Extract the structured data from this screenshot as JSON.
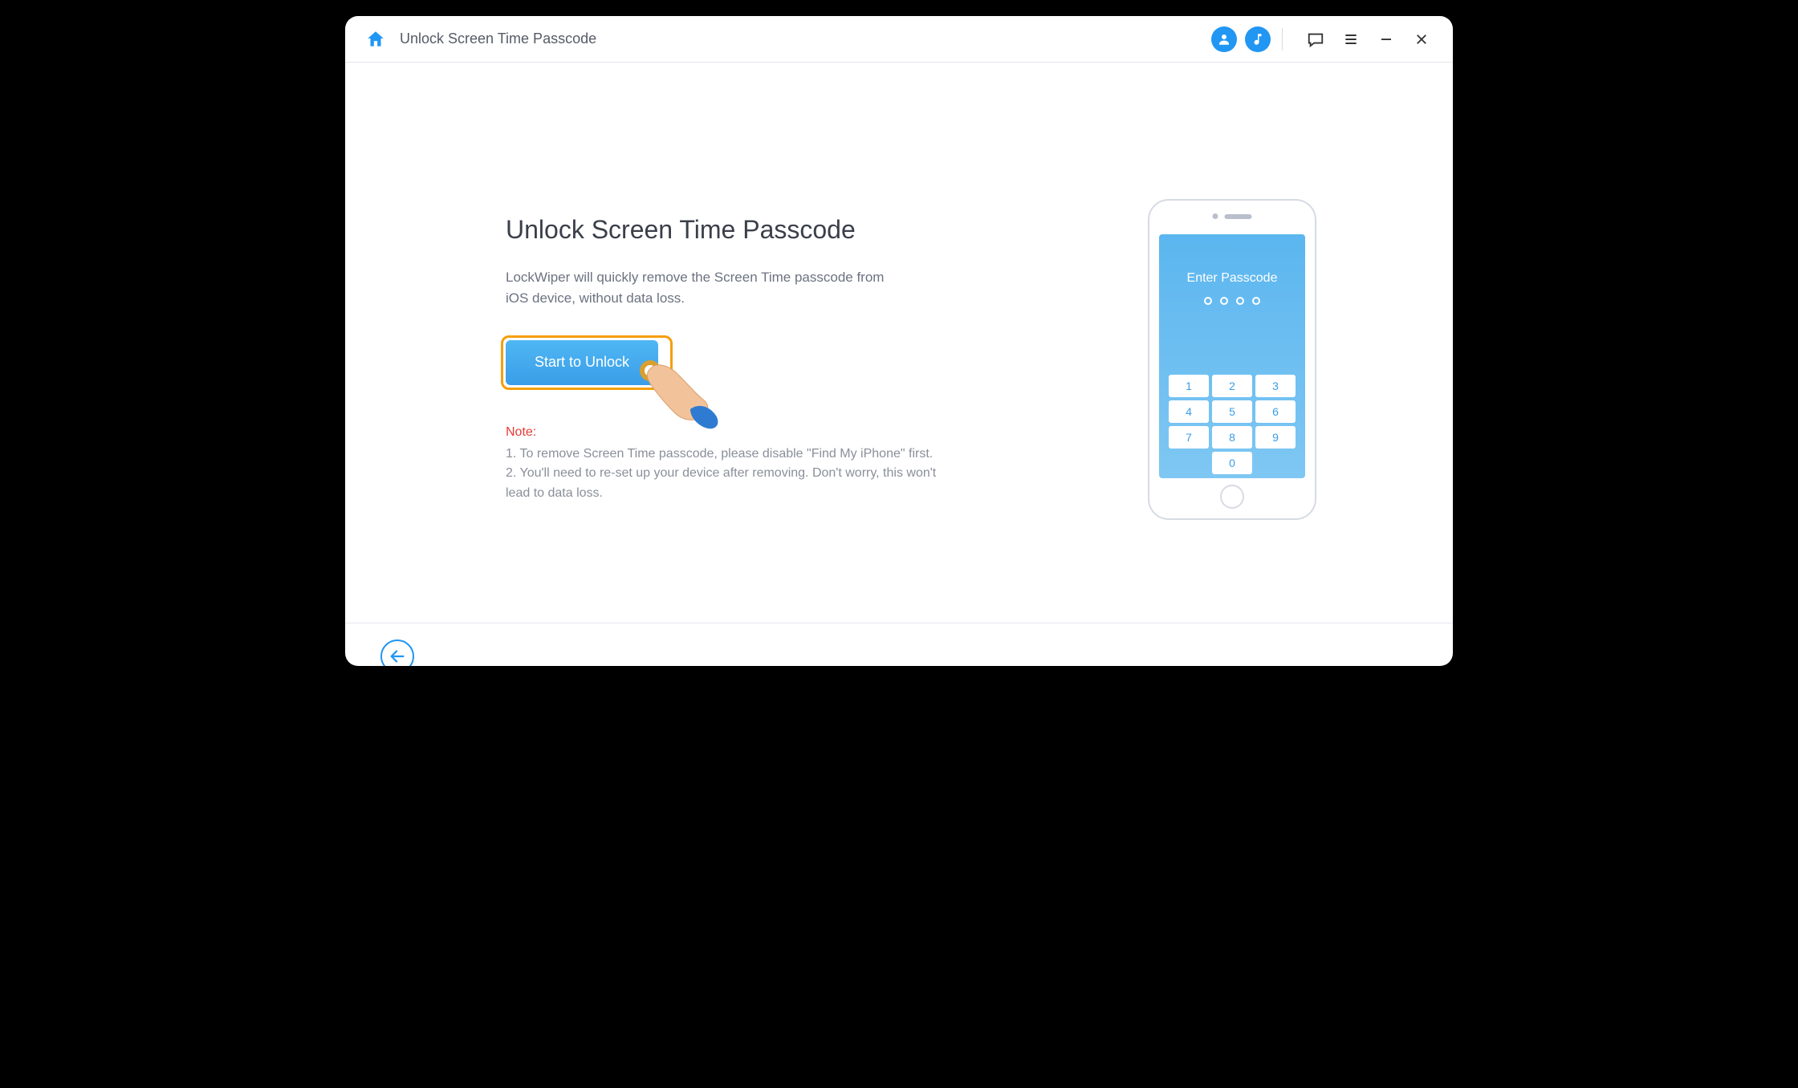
{
  "header": {
    "title": "Unlock Screen Time Passcode"
  },
  "main": {
    "heading": "Unlock Screen Time Passcode",
    "description": "LockWiper will quickly remove the Screen Time passcode from iOS device, without data loss.",
    "unlock_label": "Start to Unlock",
    "note_label": "Note:",
    "note_1": "1. To remove Screen Time passcode, please disable \"Find My iPhone\" first.",
    "note_2": "2. You'll need to re-set up your device after removing. Don't worry, this won't lead to data loss."
  },
  "phone": {
    "screen_title": "Enter Passcode",
    "keys": [
      "1",
      "2",
      "3",
      "4",
      "5",
      "6",
      "7",
      "8",
      "9",
      "0"
    ]
  }
}
